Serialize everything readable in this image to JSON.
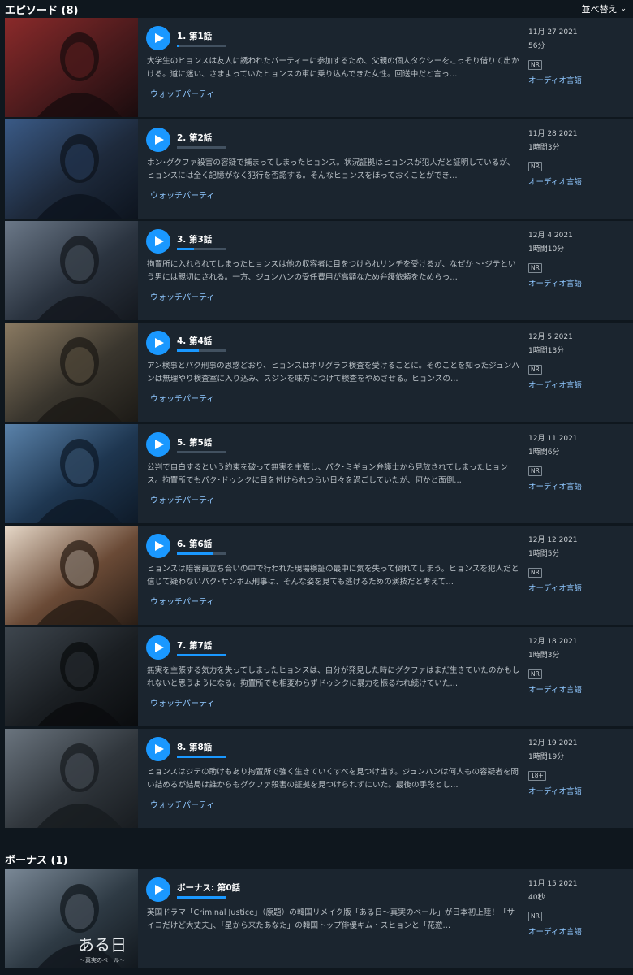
{
  "episodes_header": {
    "title": "エピソード (8)",
    "sort_label": "並べ替え"
  },
  "episodes": [
    {
      "title": "1. 第1話",
      "progress": 0.05,
      "description": "大学生のヒョンスは友人に誘われたパーティーに参加するため、父親の個人タクシーをこっそり借りて出かける。道に迷い、さまよっていたヒョンスの車に乗り込んできた女性。回送中だと言っ…",
      "watch_party": "ウォッチパーティ",
      "date": "11月 27 2021",
      "duration": "56分",
      "rating": "NR",
      "audio": "オーディオ言語",
      "thumb_colors": [
        "#4a1a1c",
        "#8a2a2a",
        "#1a0c0e"
      ]
    },
    {
      "title": "2. 第2話",
      "progress": 0.0,
      "description": "ホン･グクファ殺害の容疑で捕まってしまったヒョンス。状況証拠はヒョンスが犯人だと証明しているが、ヒョンスには全く記憶がなく犯行を否認する。そんなヒョンスをほっておくことができ…",
      "watch_party": "ウォッチパーティ",
      "date": "11月 28 2021",
      "duration": "1時間3分",
      "rating": "NR",
      "audio": "オーディオ言語",
      "thumb_colors": [
        "#1e2a3c",
        "#3a5a86",
        "#0d141e"
      ]
    },
    {
      "title": "3. 第3話",
      "progress": 0.35,
      "description": "拘置所に入れられてしまったヒョンスは他の収容者に目をつけられリンチを受けるが、なぜかト･ジテという男には親切にされる。一方、ジュンハンの受任費用が高額なため弁護依頼をためらっ…",
      "watch_party": "ウォッチパーティ",
      "date": "12月 4 2021",
      "duration": "1時間10分",
      "rating": "NR",
      "audio": "オーディオ言語",
      "thumb_colors": [
        "#2b3440",
        "#6b7888",
        "#14181e"
      ]
    },
    {
      "title": "4. 第4話",
      "progress": 0.45,
      "description": "アン検事とパク刑事の思惑どおり、ヒョンスはポリグラフ検査を受けることに。そのことを知ったジュンハンは無理やり検査室に入り込み、スジンを味方につけて検査をやめさせる。ヒョンスの…",
      "watch_party": "ウォッチパーティ",
      "date": "12月 5 2021",
      "duration": "1時間13分",
      "rating": "NR",
      "audio": "オーディオ言語",
      "thumb_colors": [
        "#3a362e",
        "#8a7a62",
        "#1c1a16"
      ]
    },
    {
      "title": "5. 第5話",
      "progress": 0.0,
      "description": "公判で自白するという約束を破って無実を主張し、パク･ミギョン弁護士から見放されてしまったヒョンス。拘置所でもパク･ドゥシクに目を付けられつらい日々を過ごしていたが、何かと面倒…",
      "watch_party": "ウォッチパーティ",
      "date": "12月 11 2021",
      "duration": "1時間6分",
      "rating": "NR",
      "audio": "オーディオ言語",
      "thumb_colors": [
        "#1e3650",
        "#5a82aa",
        "#0e1a28"
      ]
    },
    {
      "title": "6. 第6話",
      "progress": 0.75,
      "description": "ヒョンスは陪審員立ち合いの中で行われた現場検証の最中に気を失って倒れてしまう。ヒョンスを犯人だと信じて疑わないパク･サンボム刑事は、そんな姿を見ても逃げるための演技だと考えて…",
      "watch_party": "ウォッチパーティ",
      "date": "12月 12 2021",
      "duration": "1時間5分",
      "rating": "NR",
      "audio": "オーディオ言語",
      "thumb_colors": [
        "#6a4a36",
        "#e6d8c8",
        "#2a1e16"
      ]
    },
    {
      "title": "7. 第7話",
      "progress": 1.0,
      "description": "無実を主張する気力を失ってしまったヒョンスは、自分が発見した時にグクファはまだ生きていたのかもしれないと思うようになる。拘置所でも相変わらずドゥシクに暴力を振るわれ続けていた…",
      "watch_party": "ウォッチパーティ",
      "date": "12月 18 2021",
      "duration": "1時間3分",
      "rating": "NR",
      "audio": "オーディオ言語",
      "thumb_colors": [
        "#1a1e22",
        "#3e464e",
        "#0a0c0e"
      ]
    },
    {
      "title": "8. 第8話",
      "progress": 1.0,
      "description": "ヒョンスはジテの助けもあり拘置所で強く生きていくすべを見つけ出す。ジュンハンは何人もの容疑者を問い詰めるが結局は誰からもグクファ殺害の証拠を見つけられずにいた。最後の手段とし…",
      "watch_party": "ウォッチパーティ",
      "date": "12月 19 2021",
      "duration": "1時間19分",
      "rating": "18+",
      "audio": "オーディオ言語",
      "thumb_colors": [
        "#30363c",
        "#6a747e",
        "#181c20"
      ]
    }
  ],
  "bonus_header": {
    "title": "ボーナス (1)"
  },
  "bonus": [
    {
      "title": "ボーナス: 第0話",
      "progress": 1.0,
      "description": "英国ドラマ「Criminal Justice」（原題）の韓国リメイク版「ある日～真実のベール」が日本初上陸！「サイコだけど大丈夫」、「星から来たあなた」の韓国トップ俳優キム・スヒョンと「花遊…",
      "date": "11月 15 2021",
      "duration": "40秒",
      "rating": "NR",
      "audio": "オーディオ言語",
      "thumb_colors": [
        "#2e3a44",
        "#7a8896",
        "#12181e"
      ],
      "thumb_logo": "ある日",
      "thumb_logo_sub": "～真実のベール～"
    }
  ]
}
